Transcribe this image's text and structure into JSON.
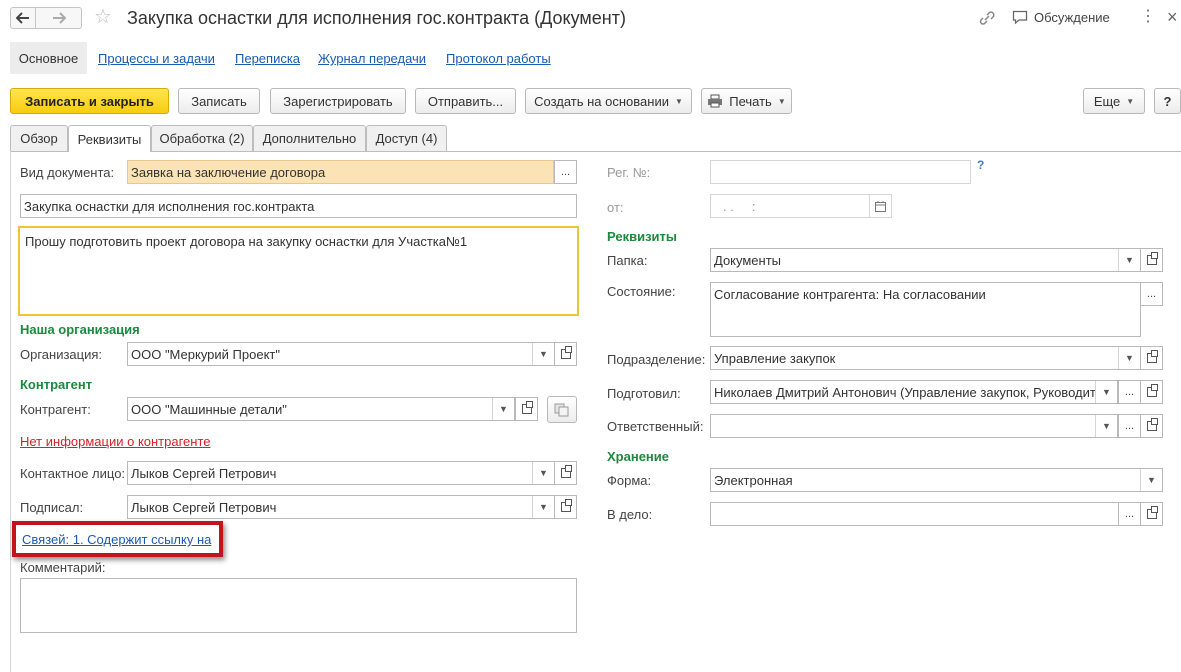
{
  "window": {
    "title": "Закупка оснастки для исполнения гос.контракта (Документ)",
    "discussion_label": "Обсуждение"
  },
  "nav_links": [
    "Основное",
    "Процессы и задачи",
    "Переписка",
    "Журнал передачи",
    "Протокол работы"
  ],
  "toolbar": {
    "save_close": "Записать и закрыть",
    "save": "Записать",
    "register": "Зарегистрировать",
    "send": "Отправить...",
    "create_based": "Создать на основании",
    "print": "Печать",
    "more": "Еще",
    "help": "?"
  },
  "tabs": [
    "Обзор",
    "Реквизиты",
    "Обработка (2)",
    "Дополнительно",
    "Доступ (4)"
  ],
  "left": {
    "doc_type_label": "Вид документа:",
    "doc_type_value": "Заявка на заключение договора",
    "title_value": "Закупка оснастки для исполнения гос.контракта",
    "content_value": "Прошу подготовить проект договора на закупку оснастки для Участка№1",
    "org_section": "Наша организация",
    "org_label": "Организация:",
    "org_value": "ООО \"Меркурий Проект\"",
    "contractor_section": "Контрагент",
    "contractor_label": "Контрагент:",
    "contractor_value": "ООО \"Машинные детали\"",
    "no_info_link": "Нет информации о контрагенте",
    "contact_label": "Контактное лицо:",
    "contact_value": "Лыков Сергей Петрович",
    "signed_label": "Подписал:",
    "signed_value": "Лыков Сергей Петрович",
    "links_link": "Связей: 1. Содержит ссылку на",
    "comment_label": "Комментарий:"
  },
  "right": {
    "reg_label": "Рег. №:",
    "reg_help": "?",
    "date_label": "от:",
    "date_value": ". .     :",
    "rekv_section": "Реквизиты",
    "folder_label": "Папка:",
    "folder_value": "Документы",
    "state_label": "Состояние:",
    "state_value": "Согласование контрагента: На согласовании",
    "dept_label": "Подразделение:",
    "dept_value": "Управление закупок",
    "prepared_label": "Подготовил:",
    "prepared_value": "Николаев Дмитрий Антонович (Управление закупок, Руководитель",
    "responsible_label": "Ответственный:",
    "storage_section": "Хранение",
    "form_label": "Форма:",
    "form_value": "Электронная",
    "case_label": "В дело:"
  }
}
